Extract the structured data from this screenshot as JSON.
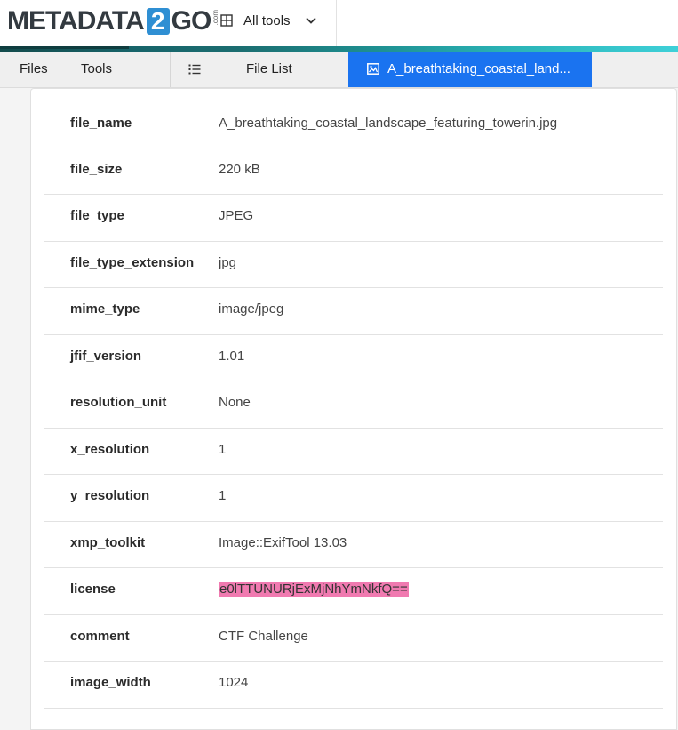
{
  "logo": {
    "text_left": "METADATA",
    "text_two": "2",
    "text_right": "GO",
    "suffix": ".com"
  },
  "header": {
    "all_tools_label": "All tools"
  },
  "tabs": {
    "files": "Files",
    "tools": "Tools",
    "file_list": "File List",
    "active_file": "A_breathtaking_coastal_land..."
  },
  "colors": {
    "active_tab": "#1a73f0",
    "highlight": "#f07ab0",
    "logo_accent": "#2f8fd3"
  },
  "metadata_rows": [
    {
      "key": "file_name",
      "value": "A_breathtaking_coastal_landscape_featuring_towerin.jpg"
    },
    {
      "key": "file_size",
      "value": "220 kB"
    },
    {
      "key": "file_type",
      "value": "JPEG"
    },
    {
      "key": "file_type_extension",
      "value": "jpg"
    },
    {
      "key": "mime_type",
      "value": "image/jpeg"
    },
    {
      "key": "jfif_version",
      "value": "1.01"
    },
    {
      "key": "resolution_unit",
      "value": "None"
    },
    {
      "key": "x_resolution",
      "value": "1"
    },
    {
      "key": "y_resolution",
      "value": "1"
    },
    {
      "key": "xmp_toolkit",
      "value": "Image::ExifTool 13.03"
    },
    {
      "key": "license",
      "value": "e0lTTUNURjExMjNhYmNkfQ==",
      "highlighted": true
    },
    {
      "key": "comment",
      "value": "CTF Challenge"
    },
    {
      "key": "image_width",
      "value": "1024"
    }
  ]
}
